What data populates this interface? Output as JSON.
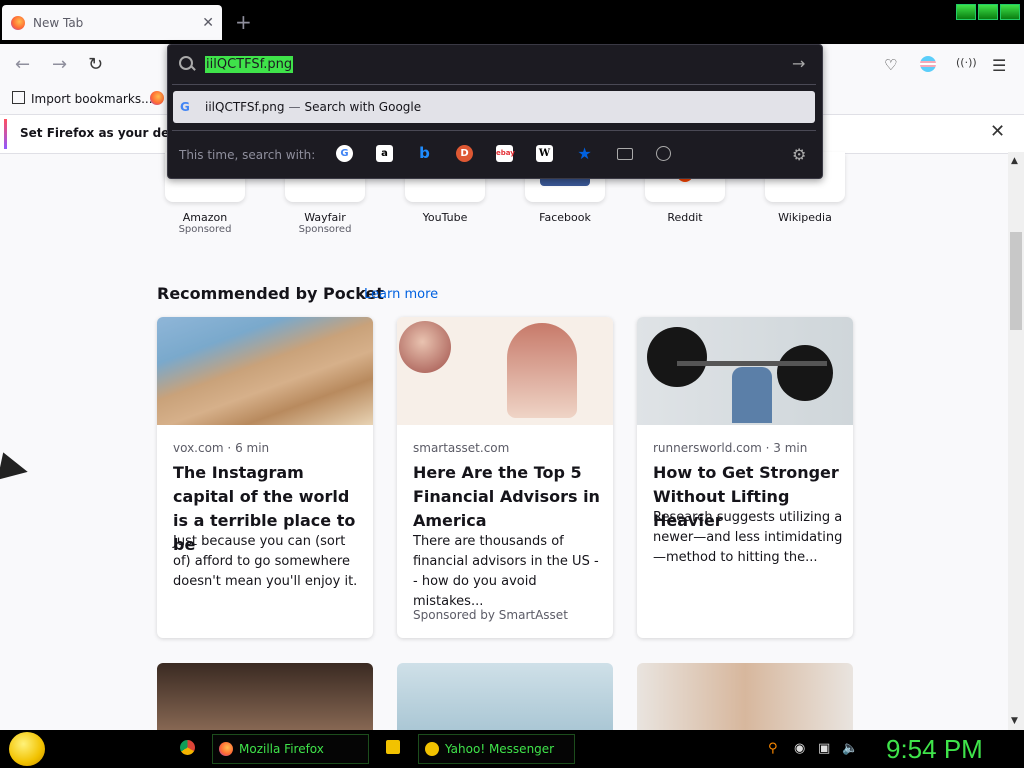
{
  "browser": {
    "tab_title": "New Tab",
    "tab_close": "✕",
    "new_tab": "+",
    "import_bookmarks": "Import bookmarks..."
  },
  "notification": {
    "text": "Set Firefox as your default",
    "close": "✕"
  },
  "urlbar": {
    "typed_text": "iilQCTFSf.png",
    "suggestion_text": "iilQCTFSf.png",
    "suggestion_separator": "—",
    "suggestion_action": "Search with Google",
    "one_time_label": "This time, search with:",
    "engines": [
      "google-icon",
      "amazon-icon",
      "bing-icon",
      "duckduckgo-icon",
      "ebay-icon",
      "wikipedia-icon",
      "bookmarks-star-icon",
      "tabs-icon",
      "history-icon"
    ],
    "settings_icon": "gear-icon"
  },
  "top_sites": [
    {
      "name": "Amazon",
      "sub": "Sponsored"
    },
    {
      "name": "Wayfair",
      "sub": "Sponsored"
    },
    {
      "name": "YouTube",
      "sub": ""
    },
    {
      "name": "Facebook",
      "sub": ""
    },
    {
      "name": "Reddit",
      "sub": ""
    },
    {
      "name": "Wikipedia",
      "sub": ""
    }
  ],
  "pocket": {
    "heading": "Recommended by Pocket",
    "learn_more": "Learn more",
    "cards": [
      {
        "source": "vox.com · 6 min",
        "title": "The Instagram capital of the world is a terrible place to be",
        "desc": "Just because you can (sort of) afford to go somewhere doesn't mean you'll enjoy it.",
        "sponsor": ""
      },
      {
        "source": "smartasset.com",
        "title": "Here Are the Top 5 Financial Advisors in America",
        "desc": "There are thousands of financial advisors in the US -- how do you avoid mistakes...",
        "sponsor": "Sponsored by SmartAsset"
      },
      {
        "source": "runnersworld.com · 3 min",
        "title": "How to Get Stronger Without Lifting Heavier",
        "desc": "Research suggests utilizing a newer—and less intimidating—method to hitting the...",
        "sponsor": ""
      }
    ]
  },
  "taskbar": {
    "firefox_label": "Mozilla Firefox",
    "yahoo_label": "Yahoo! Messenger",
    "clock": "9:54 PM"
  },
  "colors": {
    "accent_green": "#3fe34a",
    "link_blue": "#0061e0",
    "urlbar_dark": "#1c1b22"
  }
}
